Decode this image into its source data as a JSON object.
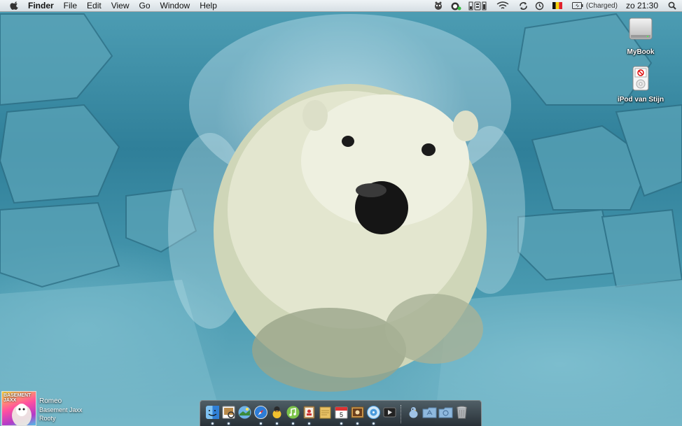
{
  "menubar": {
    "app_name": "Finder",
    "menus": [
      "File",
      "Edit",
      "View",
      "Go",
      "Window",
      "Help"
    ],
    "battery_status": "(Charged)",
    "clock": "zo 21:30",
    "status_icons": [
      "growl-icon",
      "adium-icon",
      "istat-icon",
      "wifi-icon",
      "sync-icon",
      "time-machine-icon",
      "belgium-flag-icon",
      "battery-icon",
      "spotlight-icon"
    ]
  },
  "desktop": {
    "icons": [
      {
        "label": "MyBook",
        "icon": "external-drive-icon"
      },
      {
        "label": "iPod van Stijn",
        "icon": "ipod-icon"
      }
    ]
  },
  "now_playing": {
    "album_art_text": "BASEMENT JAXX",
    "song": "Romeo",
    "artist": "Basement Jaxx",
    "album": "Rooty"
  },
  "dock": {
    "calendar_day": "5",
    "apps": [
      {
        "name": "finder-icon",
        "color": "#3d8fe0",
        "running": true
      },
      {
        "name": "preview-icon",
        "color": "#b98a4a",
        "running": true
      },
      {
        "name": "iphoto-icon",
        "color": "#6fb3e6",
        "running": false
      },
      {
        "name": "safari-icon",
        "color": "#2d7dd8",
        "running": true
      },
      {
        "name": "adium-duck-icon",
        "color": "#f2c12e",
        "running": true
      },
      {
        "name": "itunes-icon",
        "color": "#7cc34a",
        "running": true
      },
      {
        "name": "address-book-icon",
        "color": "#c9a36b",
        "running": true
      },
      {
        "name": "notes-icon",
        "color": "#e9c266",
        "running": false
      },
      {
        "name": "ical-icon",
        "color": "#ffffff",
        "running": true
      },
      {
        "name": "photo-booth-icon",
        "color": "#d6a052",
        "running": true
      },
      {
        "name": "itunes-cd-icon",
        "color": "#4a9bdc",
        "running": true
      },
      {
        "name": "dvd-player-icon",
        "color": "#222222",
        "running": false
      }
    ],
    "others": [
      {
        "name": "cyberduck-icon",
        "color": "#9fc3e6"
      },
      {
        "name": "applications-folder-icon",
        "color": "#8fb9de"
      },
      {
        "name": "downloads-folder-icon",
        "color": "#8fb9de"
      },
      {
        "name": "trash-icon",
        "color": "#b0b4b8"
      }
    ]
  }
}
